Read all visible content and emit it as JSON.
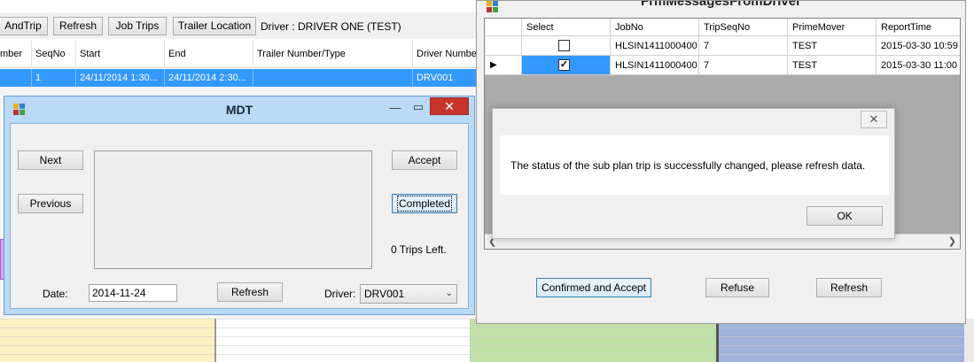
{
  "background_app": {
    "toolbar": {
      "andtrip_label": "AndTrip",
      "refresh_label": "Refresh",
      "jobtrips_label": "Job Trips",
      "trailer_location_label": "Trailer Location",
      "driver_text": "Driver : DRIVER ONE (TEST)"
    },
    "grid": {
      "columns": [
        "mber",
        "SeqNo",
        "Start",
        "End",
        "Trailer Number/Type",
        "Driver Number"
      ],
      "row": [
        "",
        "1",
        "24/11/2014 1:30...",
        "24/11/2014 2:30...",
        "",
        "DRV001"
      ]
    }
  },
  "mdt": {
    "title": "MDT",
    "next_label": "Next",
    "previous_label": "Previous",
    "accept_label": "Accept",
    "completed_label": "Completed",
    "trips_left": "0 Trips Left.",
    "date_label": "Date:",
    "date_value": "2014-11-24",
    "refresh_label": "Refresh",
    "driver_label": "Driver:",
    "driver_value": "DRV001",
    "icons": {
      "minimize": "minimize-icon",
      "maximize": "maximize-icon",
      "close": "close-icon"
    }
  },
  "messages_window": {
    "title": "FrmMessagesFromDriver",
    "columns": [
      "Select",
      "JobNo",
      "TripSeqNo",
      "PrimeMover",
      "ReportTime"
    ],
    "rows": [
      {
        "selected": false,
        "checked": false,
        "jobno": "HLSIN1411000400",
        "tripseqno": "7",
        "primemover": "TEST",
        "reporttime": "2015-03-30 10:59"
      },
      {
        "selected": true,
        "checked": true,
        "jobno": "HLSIN1411000400",
        "tripseqno": "7",
        "primemover": "TEST",
        "reporttime": "2015-03-30 11:00"
      }
    ],
    "confirm_label": "Confirmed and Accept",
    "refuse_label": "Refuse",
    "refresh_label": "Refresh"
  },
  "dialog": {
    "message": "The status of the sub plan trip is successfully changed, please refresh data.",
    "ok_label": "OK"
  },
  "colors": {
    "selection_blue": "#3399ff",
    "mdt_frame": "#b9d9f5",
    "close_red": "#c7352c"
  }
}
